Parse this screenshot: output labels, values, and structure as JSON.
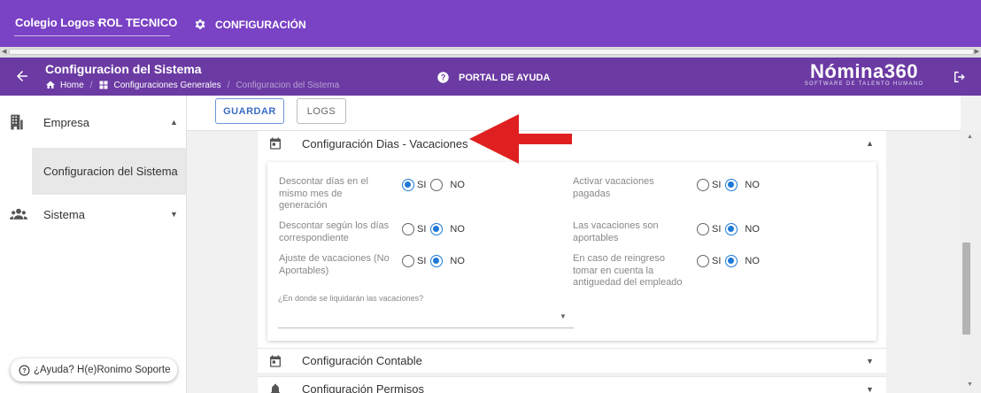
{
  "topbar": {
    "school": "Colegio Logos",
    "role": "ROL TECNICO",
    "config_label": "CONFIGURACIÓN",
    "color": "#7a42c4"
  },
  "header": {
    "title": "Configuracion del Sistema",
    "breadcrumb": [
      "Home",
      "Configuraciones Generales",
      "Configuracion del Sistema"
    ],
    "help_label": "PORTAL DE AYUDA",
    "logo_text": "Nómina360",
    "logo_tagline": "SOFTWARE DE TALENTO HUMANO",
    "color": "#6b3aa3"
  },
  "sidebar": {
    "items": [
      {
        "label": "Empresa",
        "icon": "building-icon",
        "expanded": true
      },
      {
        "label": "Configuracion del Sistema",
        "selected": true
      },
      {
        "label": "Sistema",
        "icon": "people-icon",
        "expanded": false
      }
    ],
    "help_chip": "¿Ayuda? H(e)Ronimo Soporte"
  },
  "toolbar": {
    "save_label": "GUARDAR",
    "logs_label": "LOGS"
  },
  "sections": [
    {
      "title": "Configuración Dias - Vacaciones",
      "icon": "calendar-icon",
      "expanded": true
    },
    {
      "title": "Configuración Contable",
      "icon": "calendar-icon",
      "expanded": false
    },
    {
      "title": "Configuración Permisos",
      "icon": "bell-icon",
      "expanded": false
    }
  ],
  "vacaciones": {
    "radio_yes": "SI",
    "radio_no": "NO",
    "questions": [
      {
        "text": "Descontar días en el mismo mes de generación",
        "value": "SI"
      },
      {
        "text": "Activar vacaciones pagadas",
        "value": "NO"
      },
      {
        "text": "Descontar según los días correspondiente",
        "value": "NO"
      },
      {
        "text": "Las vacaciones son aportables",
        "value": "NO"
      },
      {
        "text": "Ajuste de vacaciones (No Aportables)",
        "value": "NO"
      },
      {
        "text": "En caso de reingreso tomar en cuenta la antiguedad del empleado",
        "value": "NO"
      }
    ],
    "select_label": "¿En donde se liquidarán las vacaciones?",
    "select_value": ""
  },
  "colors": {
    "accent_blue": "#1e79d8",
    "annotation_arrow": "#e02020"
  }
}
